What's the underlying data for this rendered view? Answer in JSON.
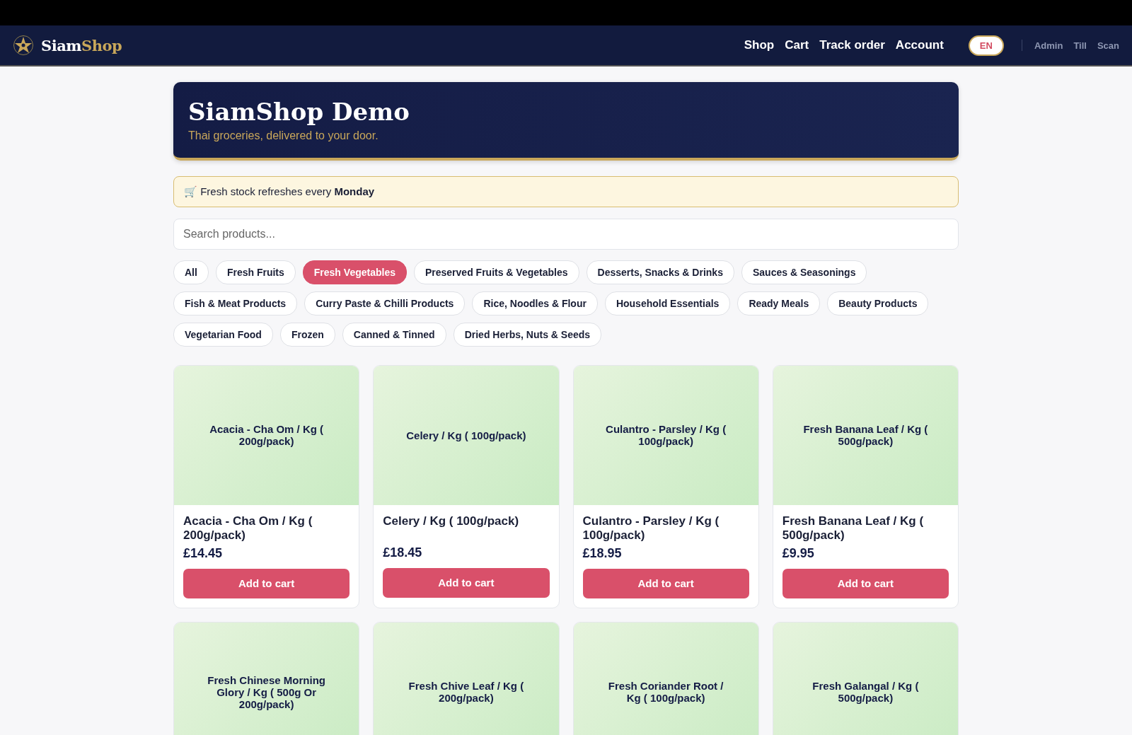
{
  "nav": {
    "brand_main": "Siam",
    "brand_accent": "Shop",
    "links": [
      "Shop",
      "Cart",
      "Track order",
      "Account"
    ],
    "language": "EN",
    "staff_links": [
      "Admin",
      "Till",
      "Scan"
    ]
  },
  "hero": {
    "title": "SiamShop Demo",
    "subtitle": "Thai groceries, delivered to your door."
  },
  "notice": "🛒 Fresh stock refreshes every **Monday**",
  "search": {
    "placeholder": "Search products..."
  },
  "categories": [
    {
      "label": "All",
      "selected": false
    },
    {
      "label": "Fresh Fruits",
      "selected": false
    },
    {
      "label": "Fresh Vegetables",
      "selected": true
    },
    {
      "label": "Preserved Fruits & Vegetables",
      "selected": false
    },
    {
      "label": "Desserts, Snacks & Drinks",
      "selected": false
    },
    {
      "label": "Sauces & Seasonings",
      "selected": false
    },
    {
      "label": "Fish & Meat Products",
      "selected": false
    },
    {
      "label": "Curry Paste & Chilli Products",
      "selected": false
    },
    {
      "label": "Rice, Noodles & Flour",
      "selected": false
    },
    {
      "label": "Household Essentials",
      "selected": false
    },
    {
      "label": "Ready Meals",
      "selected": false
    },
    {
      "label": "Beauty Products",
      "selected": false
    },
    {
      "label": "Vegetarian Food",
      "selected": false
    },
    {
      "label": "Frozen",
      "selected": false
    },
    {
      "label": "Canned & Tinned",
      "selected": false
    },
    {
      "label": "Dried Herbs, Nuts & Seeds",
      "selected": false
    }
  ],
  "products": [
    {
      "image_label": "Acacia - Cha Om / Kg ( 200g/pack)",
      "name": "Acacia - Cha Om / Kg ( 200g/pack)",
      "price": "£14.45",
      "button": "Add to cart"
    },
    {
      "image_label": "Celery / Kg ( 100g/pack)",
      "name": "Celery / Kg ( 100g/pack)",
      "price": "£18.45",
      "button": "Add to cart"
    },
    {
      "image_label": "Culantro - Parsley / Kg ( 100g/pack)",
      "name": "Culantro - Parsley / Kg ( 100g/pack)",
      "price": "£18.95",
      "button": "Add to cart"
    },
    {
      "image_label": "Fresh Banana Leaf / Kg ( 500g/pack)",
      "name": "Fresh Banana Leaf / Kg ( 500g/pack)",
      "price": "£9.95",
      "button": "Add to cart"
    },
    {
      "image_label": "Fresh Chinese Morning Glory / Kg ( 500g Or 200g/pack)"
    },
    {
      "image_label": "Fresh Chive Leaf / Kg ( 200g/pack)"
    },
    {
      "image_label": "Fresh Coriander Root / Kg ( 100g/pack)"
    },
    {
      "image_label": "Fresh Galangal / Kg ( 500g/pack)"
    }
  ]
}
